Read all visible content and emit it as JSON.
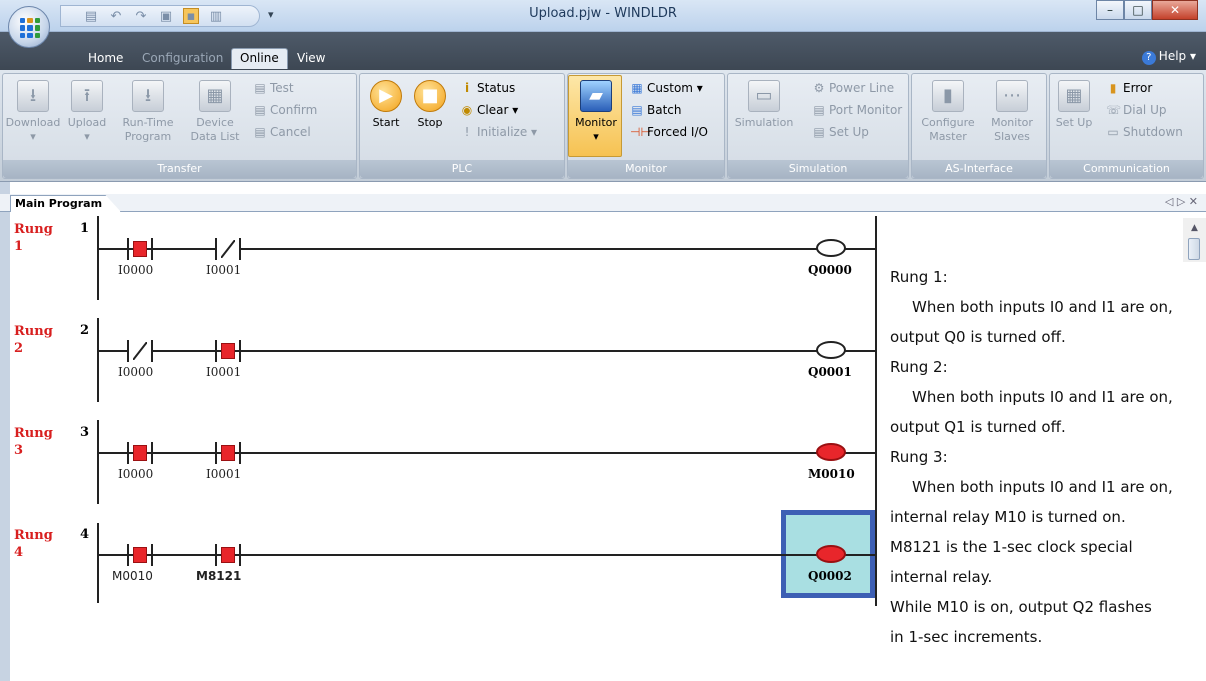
{
  "window": {
    "title": "Upload.pjw - WINDLDR"
  },
  "menu_tabs": [
    {
      "label": "Home"
    },
    {
      "label": "Configuration"
    },
    {
      "label": "Online"
    },
    {
      "label": "View"
    }
  ],
  "help_label": "Help",
  "ribbon": {
    "transfer": {
      "label": "Transfer",
      "download": "Download",
      "upload": "Upload",
      "runtime_1": "Run-Time",
      "runtime_2": "Program",
      "device_1": "Device",
      "device_2": "Data List",
      "test": "Test",
      "confirm": "Confirm",
      "cancel": "Cancel"
    },
    "plc": {
      "label": "PLC",
      "start": "Start",
      "stop": "Stop",
      "status": "Status",
      "clear": "Clear",
      "initialize": "Initialize"
    },
    "monitor": {
      "label": "Monitor",
      "monitor": "Monitor",
      "custom": "Custom",
      "batch": "Batch",
      "forced": "Forced I/O"
    },
    "simulation": {
      "label": "Simulation",
      "simulation": "Simulation",
      "power_line": "Power Line",
      "port_monitor": "Port Monitor",
      "set_up": "Set Up"
    },
    "asi": {
      "label": "AS-Interface",
      "configure_1": "Configure",
      "configure_2": "Master",
      "monitor_1": "Monitor",
      "monitor_2": "Slaves"
    },
    "communication": {
      "label": "Communication",
      "set_up": "Set Up",
      "error": "Error",
      "dial_up": "Dial Up",
      "shutdown": "Shutdown"
    }
  },
  "document_tab": "Main Program",
  "rungs": [
    {
      "label": "Rung",
      "num_a": "1",
      "num_b": "1",
      "c1": "I0000",
      "c2": "I0001",
      "out": "Q0000"
    },
    {
      "label": "Rung",
      "num_a": "2",
      "num_b": "2",
      "c1": "I0000",
      "c2": "I0001",
      "out": "Q0001"
    },
    {
      "label": "Rung",
      "num_a": "3",
      "num_b": "3",
      "c1": "I0000",
      "c2": "I0001",
      "out": "M0010"
    },
    {
      "label": "Rung",
      "num_a": "4",
      "num_b": "4",
      "c1": "M0010",
      "c2": "M8121",
      "out": "Q0002"
    }
  ],
  "comment": {
    "l1": "Rung 1:",
    "l2": "When both inputs I0 and I1 are on,",
    "l3": "output Q0 is turned off.",
    "l4": "Rung 2:",
    "l5": "When both inputs I0 and I1 are on,",
    "l6": "output Q1 is turned off.",
    "l7": "Rung 3:",
    "l8": "When both inputs I0 and I1 are on,",
    "l9": "internal relay M10 is turned on.",
    "l10": "M8121 is the 1-sec clock special",
    "l11": "internal relay.",
    "l12": "While M10 is on, output Q2 flashes",
    "l13": "in 1-sec increments."
  },
  "colors": {
    "contact_on": "#e8262b",
    "rung_label": "#d81f1f",
    "highlight_box": "#a9dfe2"
  }
}
